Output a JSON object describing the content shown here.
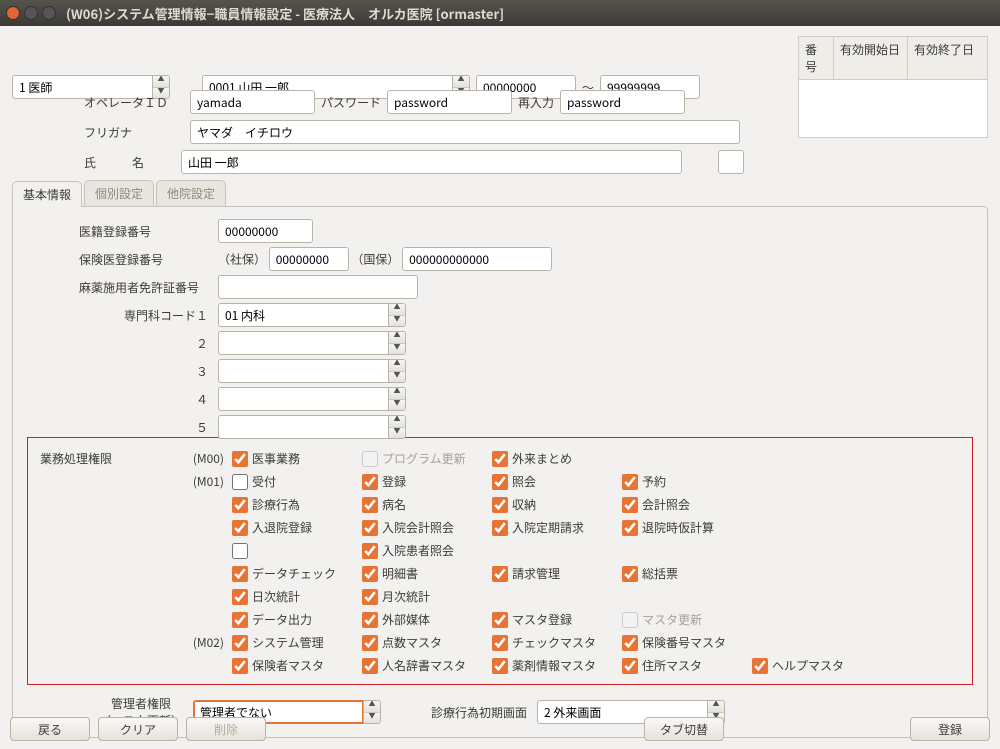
{
  "window": {
    "title": "(W06)システム管理情報−職員情報設定 - 医療法人　オルカ医院  [ormaster]"
  },
  "top": {
    "role": "1 医師",
    "staff": "0001 山田 一郎",
    "from": "00000000",
    "tilde": "〜",
    "to": "99999999",
    "col_no": "番号",
    "col_start": "有効開始日",
    "col_end": "有効終了日"
  },
  "fields": {
    "op_id_label": "オペレータＩＤ",
    "op_id": "yamada",
    "pw_label": "パスワード",
    "pw": "password",
    "pw2_label": "再入力",
    "pw2": "password",
    "kana_label": "フリガナ",
    "kana": "ヤマダ　イチロウ",
    "name_label": "氏　　　名",
    "name": "山田 一郎"
  },
  "tabs": {
    "t1": "基本情報",
    "t2": "個別設定",
    "t3": "他院設定"
  },
  "reg": {
    "med_reg_label": "医籍登録番号",
    "med_reg": "00000000",
    "ins_reg_label": "保険医登録番号",
    "shaho": "（社保）",
    "shaho_val": "00000000",
    "kokuho": "（国保）",
    "kokuho_val": "000000000000",
    "drug_label": "麻薬施用者免許証番号",
    "spec_label": "専門科コード１",
    "spec1": "01 内科",
    "n2": "２",
    "n3": "３",
    "n4": "４",
    "n5": "５"
  },
  "perm": {
    "header": "業務処理権限",
    "m00": "(M00)",
    "m01": "(M01)",
    "m02": "(M02)",
    "c_iji": "医事業務",
    "c_prog": "プログラム更新",
    "c_gairai": "外来まとめ",
    "c_uke": "受付",
    "c_toroku": "登録",
    "c_shokai": "照会",
    "c_yoyaku": "予約",
    "c_shinryo": "診療行為",
    "c_byomei": "病名",
    "c_shuno": "収納",
    "c_kaikei": "会計照会",
    "c_nyutai": "入退院登録",
    "c_nyukaikei": "入院会計照会",
    "c_nyuteiki": "入院定期請求",
    "c_taiin": "退院時仮計算",
    "c_blank": "",
    "c_nyukanja": "入院患者照会",
    "c_datacheck": "データチェック",
    "c_meisai": "明細書",
    "c_seikyu": "請求管理",
    "c_soukatsu": "総括票",
    "c_nichiji": "日次統計",
    "c_getsuji": "月次統計",
    "c_dataout": "データ出力",
    "c_gaibu": "外部媒体",
    "c_master": "マスタ登録",
    "c_masterup": "マスタ更新",
    "c_system": "システム管理",
    "c_tensu": "点数マスタ",
    "c_check": "チェックマスタ",
    "c_hokenno": "保険番号マスタ",
    "c_hokensha": "保険者マスタ",
    "c_jinmei": "人名辞書マスタ",
    "c_yakuzai": "薬剤情報マスタ",
    "c_jusho": "住所マスタ",
    "c_help": "ヘルプマスタ"
  },
  "admin": {
    "label1": "管理者権限",
    "label2": "（マスタ更新）",
    "value": "管理者でない",
    "init_label": "診療行為初期画面",
    "init_value": "2 外来画面"
  },
  "buttons": {
    "back": "戻る",
    "clear": "クリア",
    "delete": "削除",
    "tab": "タブ切替",
    "register": "登録"
  }
}
